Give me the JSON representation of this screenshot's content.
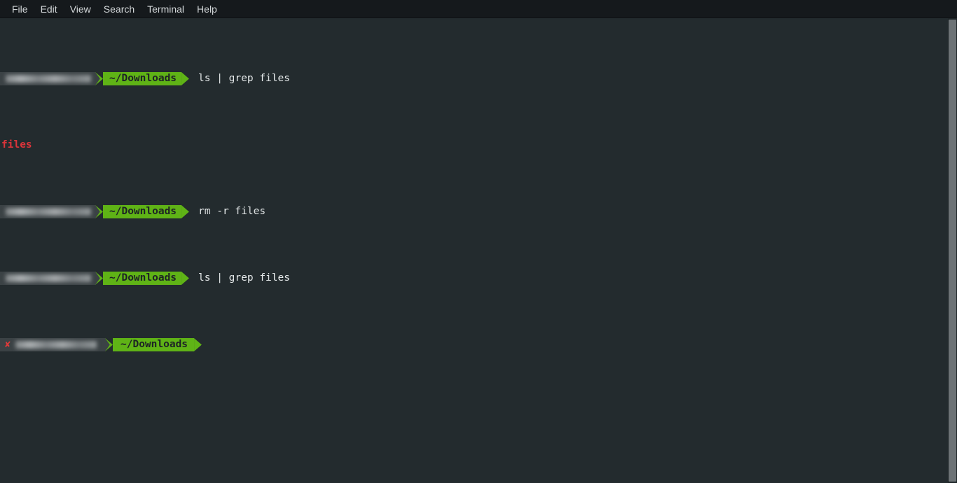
{
  "window": {
    "app": "Terminal",
    "bg_color": "#232b2e",
    "menubar_color": "#15191c"
  },
  "menubar": {
    "items": [
      {
        "label": "File"
      },
      {
        "label": "Edit"
      },
      {
        "label": "View"
      },
      {
        "label": "Search"
      },
      {
        "label": "Terminal"
      },
      {
        "label": "Help"
      }
    ]
  },
  "theme": {
    "prompt_green": "#5fb316",
    "prompt_user_bg": "#3b4245",
    "prompt_text_dark": "#1d2225",
    "command_text": "#e3e7e8",
    "error_red": "#d9343a",
    "scrollbar_thumb": "#6d7376"
  },
  "terminal": {
    "lines": [
      {
        "kind": "prompt",
        "user_host": "",
        "user_host_redacted": true,
        "path": "~/Downloads",
        "command": "ls | grep files",
        "exit_error": false
      },
      {
        "kind": "output",
        "text": "files",
        "color": "#d9343a"
      },
      {
        "kind": "prompt",
        "user_host": "",
        "user_host_redacted": true,
        "path": "~/Downloads",
        "command": "rm -r files",
        "exit_error": false
      },
      {
        "kind": "prompt",
        "user_host": "",
        "user_host_redacted": true,
        "path": "~/Downloads",
        "command": "ls | grep files",
        "exit_error": false
      },
      {
        "kind": "prompt",
        "user_host": "",
        "user_host_redacted": true,
        "path": "~/Downloads",
        "command": "",
        "exit_error": true,
        "exit_marker": "✘"
      }
    ]
  },
  "scrollbar": {
    "position": "right",
    "thumb_top_pct": 0,
    "thumb_height_pct": 99
  }
}
